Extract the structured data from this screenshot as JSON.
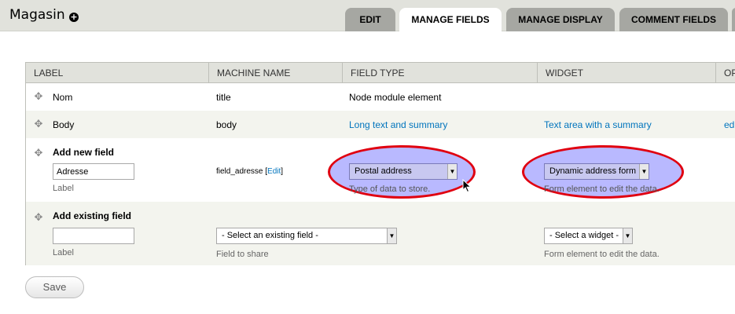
{
  "page": {
    "title": "Magasin",
    "add_icon": "plus-circle-icon"
  },
  "tabs": [
    {
      "label": "EDIT",
      "active": false
    },
    {
      "label": "MANAGE FIELDS",
      "active": true
    },
    {
      "label": "MANAGE DISPLAY",
      "active": false
    },
    {
      "label": "COMMENT FIELDS",
      "active": false
    }
  ],
  "table": {
    "columns": [
      "LABEL",
      "MACHINE NAME",
      "FIELD TYPE",
      "WIDGET",
      "OP"
    ],
    "rows": [
      {
        "label": "Nom",
        "machine_name": "title",
        "field_type": "Node module element",
        "widget": ""
      },
      {
        "label": "Body",
        "machine_name": "body",
        "field_type": "Long text and summary",
        "widget": "Text area with a summary",
        "op": "edi"
      }
    ],
    "new_field": {
      "heading": "Add new field",
      "label_value": "Adresse",
      "label_caption": "Label",
      "machine_name": "field_adresse",
      "machine_edit": "Edit",
      "field_type_selected": "Postal address",
      "field_type_desc": "Type of data to store.",
      "widget_selected": "Dynamic address form",
      "widget_desc": "Form element to edit the data."
    },
    "existing_field": {
      "heading": "Add existing field",
      "label_value": "",
      "label_caption": "Label",
      "field_selected": "- Select an existing field -",
      "field_desc": "Field to share",
      "widget_selected": "- Select a widget -",
      "widget_desc": "Form element to edit the data."
    }
  },
  "actions": {
    "save_label": "Save"
  },
  "colors": {
    "link": "#0074bd",
    "highlight_oval": "#e00010",
    "highlight_fill": "#8080ff"
  }
}
